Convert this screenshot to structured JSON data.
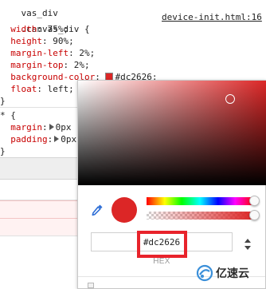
{
  "styles": {
    "rule_selector": ".canvas_div {",
    "rule_source": "device-init.html:16",
    "declarations": [
      {
        "name": "width",
        "value": "75%;"
      },
      {
        "name": "height",
        "value": "90%;"
      },
      {
        "name": "margin-left",
        "value": "2%;"
      },
      {
        "name": "margin-top",
        "value": "2%;"
      },
      {
        "name": "background-color",
        "value": "#dc2626;"
      },
      {
        "name": "float",
        "value": "left;"
      }
    ],
    "rule_close": "}",
    "universal_selector": "* {",
    "universal_declarations": [
      {
        "name": "margin",
        "value": "0px"
      },
      {
        "name": "padding",
        "value": "0px"
      }
    ],
    "universal_close": "}",
    "top_partial_text": "vas_div"
  },
  "color_picker": {
    "current_color": "#dc2626",
    "hex_value": "#dc2626",
    "format_label": "HEX",
    "hue_position": 1.0,
    "alpha_position": 1.0
  },
  "watermark": {
    "text": "亿速云"
  },
  "colors": {
    "accent": "#dc2626",
    "highlight": "#e8232b",
    "property_name": "#c80000"
  },
  "icons": {
    "eyedropper": "eyedropper-icon",
    "format_toggle": "up-down-arrows-icon",
    "palette": "palette-icon",
    "expand": "expand-triangle-icon"
  }
}
